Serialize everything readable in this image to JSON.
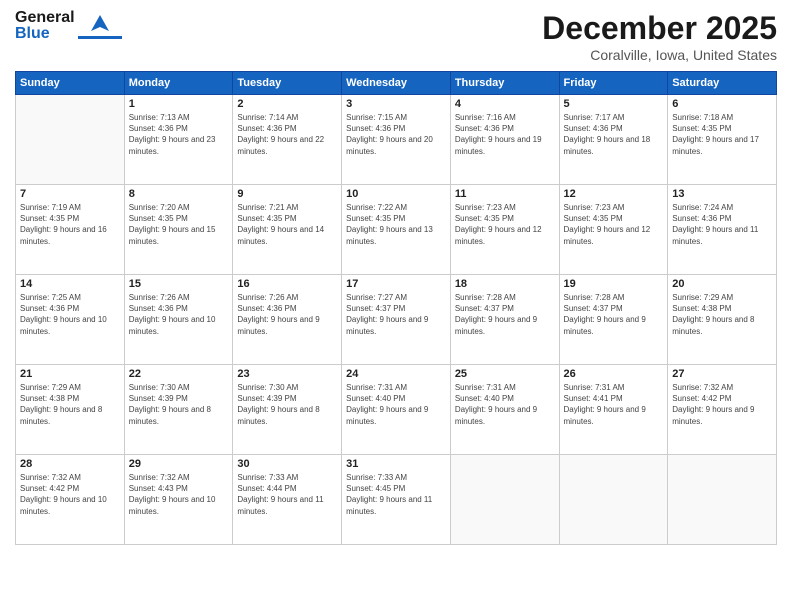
{
  "header": {
    "logo_general": "General",
    "logo_blue": "Blue",
    "title": "December 2025",
    "subtitle": "Coralville, Iowa, United States"
  },
  "calendar": {
    "days_of_week": [
      "Sunday",
      "Monday",
      "Tuesday",
      "Wednesday",
      "Thursday",
      "Friday",
      "Saturday"
    ],
    "weeks": [
      [
        {
          "day": "",
          "sunrise": "",
          "sunset": "",
          "daylight": ""
        },
        {
          "day": "1",
          "sunrise": "Sunrise: 7:13 AM",
          "sunset": "Sunset: 4:36 PM",
          "daylight": "Daylight: 9 hours and 23 minutes."
        },
        {
          "day": "2",
          "sunrise": "Sunrise: 7:14 AM",
          "sunset": "Sunset: 4:36 PM",
          "daylight": "Daylight: 9 hours and 22 minutes."
        },
        {
          "day": "3",
          "sunrise": "Sunrise: 7:15 AM",
          "sunset": "Sunset: 4:36 PM",
          "daylight": "Daylight: 9 hours and 20 minutes."
        },
        {
          "day": "4",
          "sunrise": "Sunrise: 7:16 AM",
          "sunset": "Sunset: 4:36 PM",
          "daylight": "Daylight: 9 hours and 19 minutes."
        },
        {
          "day": "5",
          "sunrise": "Sunrise: 7:17 AM",
          "sunset": "Sunset: 4:36 PM",
          "daylight": "Daylight: 9 hours and 18 minutes."
        },
        {
          "day": "6",
          "sunrise": "Sunrise: 7:18 AM",
          "sunset": "Sunset: 4:35 PM",
          "daylight": "Daylight: 9 hours and 17 minutes."
        }
      ],
      [
        {
          "day": "7",
          "sunrise": "Sunrise: 7:19 AM",
          "sunset": "Sunset: 4:35 PM",
          "daylight": "Daylight: 9 hours and 16 minutes."
        },
        {
          "day": "8",
          "sunrise": "Sunrise: 7:20 AM",
          "sunset": "Sunset: 4:35 PM",
          "daylight": "Daylight: 9 hours and 15 minutes."
        },
        {
          "day": "9",
          "sunrise": "Sunrise: 7:21 AM",
          "sunset": "Sunset: 4:35 PM",
          "daylight": "Daylight: 9 hours and 14 minutes."
        },
        {
          "day": "10",
          "sunrise": "Sunrise: 7:22 AM",
          "sunset": "Sunset: 4:35 PM",
          "daylight": "Daylight: 9 hours and 13 minutes."
        },
        {
          "day": "11",
          "sunrise": "Sunrise: 7:23 AM",
          "sunset": "Sunset: 4:35 PM",
          "daylight": "Daylight: 9 hours and 12 minutes."
        },
        {
          "day": "12",
          "sunrise": "Sunrise: 7:23 AM",
          "sunset": "Sunset: 4:35 PM",
          "daylight": "Daylight: 9 hours and 12 minutes."
        },
        {
          "day": "13",
          "sunrise": "Sunrise: 7:24 AM",
          "sunset": "Sunset: 4:36 PM",
          "daylight": "Daylight: 9 hours and 11 minutes."
        }
      ],
      [
        {
          "day": "14",
          "sunrise": "Sunrise: 7:25 AM",
          "sunset": "Sunset: 4:36 PM",
          "daylight": "Daylight: 9 hours and 10 minutes."
        },
        {
          "day": "15",
          "sunrise": "Sunrise: 7:26 AM",
          "sunset": "Sunset: 4:36 PM",
          "daylight": "Daylight: 9 hours and 10 minutes."
        },
        {
          "day": "16",
          "sunrise": "Sunrise: 7:26 AM",
          "sunset": "Sunset: 4:36 PM",
          "daylight": "Daylight: 9 hours and 9 minutes."
        },
        {
          "day": "17",
          "sunrise": "Sunrise: 7:27 AM",
          "sunset": "Sunset: 4:37 PM",
          "daylight": "Daylight: 9 hours and 9 minutes."
        },
        {
          "day": "18",
          "sunrise": "Sunrise: 7:28 AM",
          "sunset": "Sunset: 4:37 PM",
          "daylight": "Daylight: 9 hours and 9 minutes."
        },
        {
          "day": "19",
          "sunrise": "Sunrise: 7:28 AM",
          "sunset": "Sunset: 4:37 PM",
          "daylight": "Daylight: 9 hours and 9 minutes."
        },
        {
          "day": "20",
          "sunrise": "Sunrise: 7:29 AM",
          "sunset": "Sunset: 4:38 PM",
          "daylight": "Daylight: 9 hours and 8 minutes."
        }
      ],
      [
        {
          "day": "21",
          "sunrise": "Sunrise: 7:29 AM",
          "sunset": "Sunset: 4:38 PM",
          "daylight": "Daylight: 9 hours and 8 minutes."
        },
        {
          "day": "22",
          "sunrise": "Sunrise: 7:30 AM",
          "sunset": "Sunset: 4:39 PM",
          "daylight": "Daylight: 9 hours and 8 minutes."
        },
        {
          "day": "23",
          "sunrise": "Sunrise: 7:30 AM",
          "sunset": "Sunset: 4:39 PM",
          "daylight": "Daylight: 9 hours and 8 minutes."
        },
        {
          "day": "24",
          "sunrise": "Sunrise: 7:31 AM",
          "sunset": "Sunset: 4:40 PM",
          "daylight": "Daylight: 9 hours and 9 minutes."
        },
        {
          "day": "25",
          "sunrise": "Sunrise: 7:31 AM",
          "sunset": "Sunset: 4:40 PM",
          "daylight": "Daylight: 9 hours and 9 minutes."
        },
        {
          "day": "26",
          "sunrise": "Sunrise: 7:31 AM",
          "sunset": "Sunset: 4:41 PM",
          "daylight": "Daylight: 9 hours and 9 minutes."
        },
        {
          "day": "27",
          "sunrise": "Sunrise: 7:32 AM",
          "sunset": "Sunset: 4:42 PM",
          "daylight": "Daylight: 9 hours and 9 minutes."
        }
      ],
      [
        {
          "day": "28",
          "sunrise": "Sunrise: 7:32 AM",
          "sunset": "Sunset: 4:42 PM",
          "daylight": "Daylight: 9 hours and 10 minutes."
        },
        {
          "day": "29",
          "sunrise": "Sunrise: 7:32 AM",
          "sunset": "Sunset: 4:43 PM",
          "daylight": "Daylight: 9 hours and 10 minutes."
        },
        {
          "day": "30",
          "sunrise": "Sunrise: 7:33 AM",
          "sunset": "Sunset: 4:44 PM",
          "daylight": "Daylight: 9 hours and 11 minutes."
        },
        {
          "day": "31",
          "sunrise": "Sunrise: 7:33 AM",
          "sunset": "Sunset: 4:45 PM",
          "daylight": "Daylight: 9 hours and 11 minutes."
        },
        {
          "day": "",
          "sunrise": "",
          "sunset": "",
          "daylight": ""
        },
        {
          "day": "",
          "sunrise": "",
          "sunset": "",
          "daylight": ""
        },
        {
          "day": "",
          "sunrise": "",
          "sunset": "",
          "daylight": ""
        }
      ]
    ]
  }
}
